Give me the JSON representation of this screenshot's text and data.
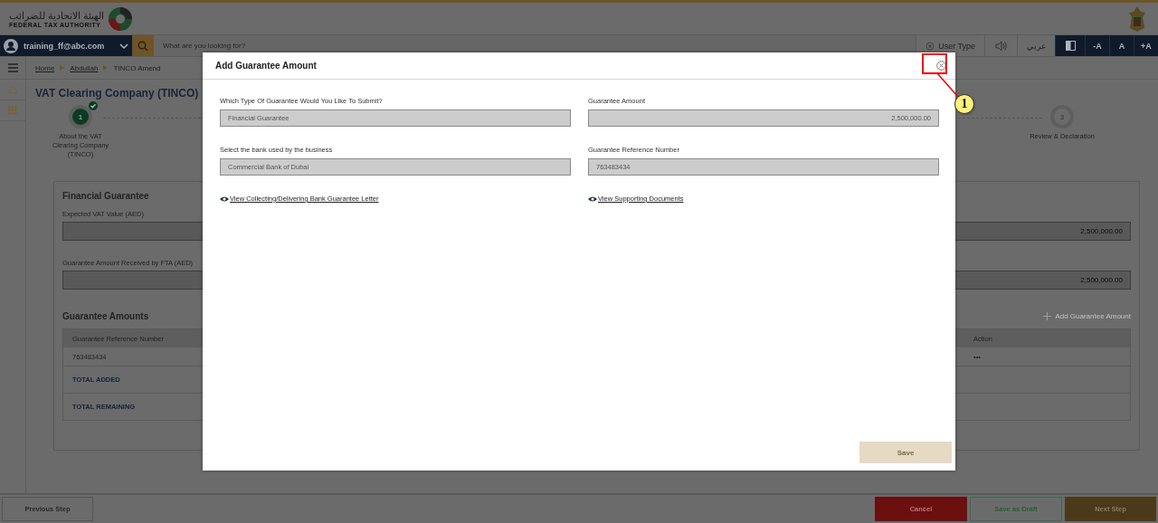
{
  "header": {
    "logo_arabic": "الهيئة الاتحادية للضرائب",
    "logo_english": "FEDERAL TAX AUTHORITY"
  },
  "nav": {
    "user": "training_ff@abc.com",
    "search_placeholder": "What are you looking for?",
    "user_type": "User Type",
    "language": "عربي",
    "font_buttons": [
      "-A",
      "A",
      "+A"
    ]
  },
  "breadcrumb": [
    {
      "label": "Home",
      "kind": "link"
    },
    {
      "label": "Abdullah",
      "kind": "link"
    },
    {
      "label": "TINCO Amend",
      "kind": "current"
    }
  ],
  "page": {
    "title": "VAT Clearing Company (TINCO)",
    "steps": [
      {
        "number": "1",
        "label": "About the VAT Clearing Company (TINCO)",
        "completed": true
      },
      {
        "number": "3",
        "label": "Review & Declaration",
        "completed": false
      }
    ],
    "card": {
      "title": "Financial Guarantee",
      "fields": [
        {
          "label": "Expected VAT Value (AED)",
          "value": "2,500,000.00"
        },
        {
          "label": "Guarantee Amount Received by FTA (AED)",
          "value": "2,500,000.00"
        }
      ],
      "section_title": "Guarantee Amounts",
      "add_link": "Add Guarantee Amount",
      "table": {
        "columns": [
          "Guarantee Reference Number",
          "Action"
        ],
        "rows": [
          [
            "763483434",
            "•••"
          ]
        ],
        "totals": [
          "TOTAL ADDED",
          "TOTAL REMAINING"
        ]
      }
    }
  },
  "modal": {
    "title": "Add Guarantee Amount",
    "fields": [
      {
        "label": "Which Type Of Guarantee Would You Like To Submit?",
        "value": "Financial Guarantee",
        "kind": "text"
      },
      {
        "label": "Guarantee Amount",
        "value": "2,500,000.00",
        "kind": "amount"
      },
      {
        "label": "Select the bank used by the business",
        "value": "Commercial Bank of Dubai",
        "kind": "text"
      },
      {
        "label": "Guarantee Reference Number",
        "value": "763483434",
        "kind": "text"
      }
    ],
    "links": [
      "View Collecting/Delivering Bank Guarantee Letter",
      "View Supporting Documents"
    ],
    "save": "Save"
  },
  "callout": {
    "number": "1"
  },
  "footer": {
    "previous": "Previous Step",
    "cancel": "Cancel",
    "save_draft": "Save as Draft",
    "next": "Next Step"
  }
}
